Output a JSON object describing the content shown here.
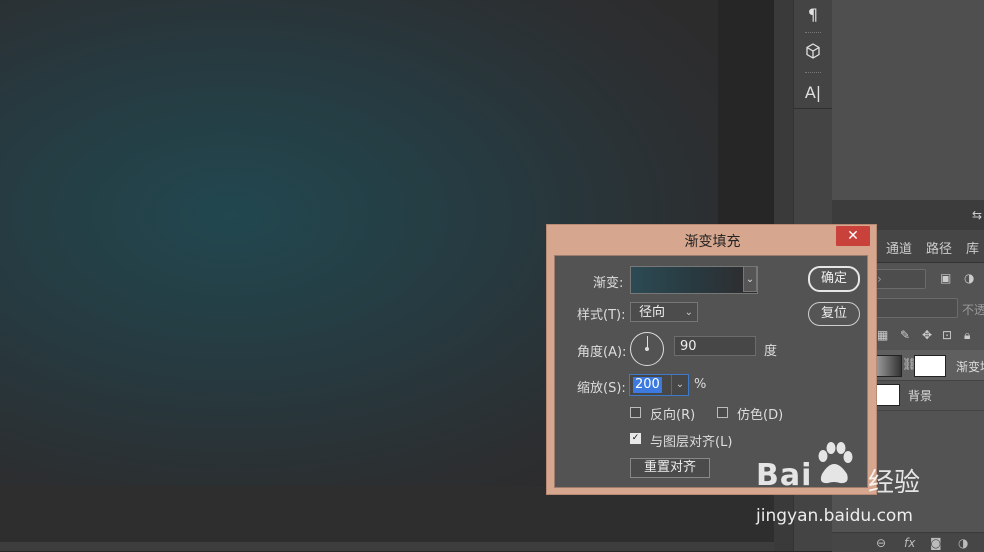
{
  "canvas": {
    "gradient_colors": [
      "#22474f",
      "#2d2c2d"
    ]
  },
  "tools": [
    {
      "name": "paragraph-icon",
      "glyph": "¶"
    },
    {
      "name": "3d-cube-icon",
      "glyph": "⬡"
    },
    {
      "name": "character-icon",
      "glyph": "A|"
    }
  ],
  "layers_panel": {
    "tabs": [
      "通道",
      "路径",
      "库"
    ],
    "opacity_label": "不透",
    "layers": [
      {
        "name": "渐变填",
        "selected": true
      },
      {
        "name": "背景",
        "selected": false
      }
    ]
  },
  "dialog": {
    "title": "渐变填充",
    "close": "✕",
    "gradient_label": "渐变:",
    "style_label": "样式(T):",
    "style_value": "径向",
    "angle_label": "角度(A):",
    "angle_value": "90",
    "angle_unit": "度",
    "scale_label": "缩放(S):",
    "scale_value": "200",
    "scale_unit": "%",
    "reverse_label": "反向(R)",
    "reverse_checked": false,
    "dither_label": "仿色(D)",
    "dither_checked": false,
    "align_label": "与图层对齐(L)",
    "align_checked": true,
    "reset_align_label": "重置对齐",
    "ok_label": "确定",
    "reset_label": "复位",
    "gradient_colors": [
      "#2d4a54",
      "#2f2b2c"
    ]
  },
  "watermark": {
    "brand": "Bai",
    "brand_tail": "经验",
    "url": "jingyan.baidu.com"
  }
}
